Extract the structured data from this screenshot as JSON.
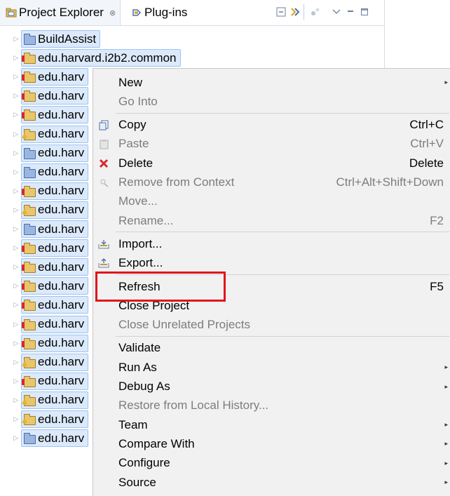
{
  "tabs": [
    {
      "label": "Project Explorer",
      "close_glyph": "⊗",
      "icon": "project-explorer-icon"
    },
    {
      "label": "Plug-ins",
      "icon": "plugins-icon"
    }
  ],
  "view_toolbar": [
    "collapse-all-icon",
    "link-with-editor-icon",
    "filter-icon",
    "view-menu-icon",
    "minimize-icon",
    "maximize-icon"
  ],
  "tree": [
    {
      "label": "BuildAssist",
      "marker": "none",
      "folder": "plain"
    },
    {
      "label": "edu.harvard.i2b2.common",
      "marker": "error",
      "folder": "yellow"
    },
    {
      "label": "edu.harv",
      "marker": "error",
      "folder": "yellow"
    },
    {
      "label": "edu.harv",
      "marker": "error",
      "folder": "yellow"
    },
    {
      "label": "edu.harv",
      "marker": "error",
      "folder": "yellow"
    },
    {
      "label": "edu.harv",
      "marker": "warning",
      "folder": "yellow"
    },
    {
      "label": "edu.harv",
      "marker": "none",
      "folder": "plain"
    },
    {
      "label": "edu.harv",
      "marker": "none",
      "folder": "plain"
    },
    {
      "label": "edu.harv",
      "marker": "error",
      "folder": "yellow"
    },
    {
      "label": "edu.harv",
      "marker": "warning",
      "folder": "yellow"
    },
    {
      "label": "edu.harv",
      "marker": "none",
      "folder": "plain"
    },
    {
      "label": "edu.harv",
      "marker": "error",
      "folder": "yellow"
    },
    {
      "label": "edu.harv",
      "marker": "error",
      "folder": "yellow"
    },
    {
      "label": "edu.harv",
      "marker": "error",
      "folder": "yellow"
    },
    {
      "label": "edu.harv",
      "marker": "error",
      "folder": "yellow"
    },
    {
      "label": "edu.harv",
      "marker": "error",
      "folder": "yellow"
    },
    {
      "label": "edu.harv",
      "marker": "error",
      "folder": "yellow"
    },
    {
      "label": "edu.harv",
      "marker": "warning",
      "folder": "yellow"
    },
    {
      "label": "edu.harv",
      "marker": "error",
      "folder": "yellow"
    },
    {
      "label": "edu.harv",
      "marker": "warning",
      "folder": "yellow"
    },
    {
      "label": "edu.harv",
      "marker": "warning",
      "folder": "yellow"
    },
    {
      "label": "edu.harv",
      "marker": "none",
      "folder": "plain"
    }
  ],
  "menu": {
    "items": [
      {
        "label": "New",
        "key": "",
        "submenu": true,
        "enabled": true,
        "icon": ""
      },
      {
        "label": "Go Into",
        "key": "",
        "submenu": false,
        "enabled": false,
        "icon": ""
      },
      {
        "sep": true
      },
      {
        "label": "Copy",
        "key": "Ctrl+C",
        "submenu": false,
        "enabled": true,
        "icon": "copy-icon"
      },
      {
        "label": "Paste",
        "key": "Ctrl+V",
        "submenu": false,
        "enabled": false,
        "icon": "paste-icon"
      },
      {
        "label": "Delete",
        "key": "Delete",
        "submenu": false,
        "enabled": true,
        "icon": "delete-icon"
      },
      {
        "label": "Remove from Context",
        "key": "Ctrl+Alt+Shift+Down",
        "submenu": false,
        "enabled": false,
        "icon": "remove-context-icon"
      },
      {
        "label": "Move...",
        "key": "",
        "submenu": false,
        "enabled": false,
        "icon": ""
      },
      {
        "label": "Rename...",
        "key": "F2",
        "submenu": false,
        "enabled": false,
        "icon": ""
      },
      {
        "sep": true
      },
      {
        "label": "Import...",
        "key": "",
        "submenu": false,
        "enabled": true,
        "icon": "import-icon"
      },
      {
        "label": "Export...",
        "key": "",
        "submenu": false,
        "enabled": true,
        "icon": "export-icon"
      },
      {
        "sep": true
      },
      {
        "label": "Refresh",
        "key": "F5",
        "submenu": false,
        "enabled": true,
        "icon": ""
      },
      {
        "label": "Close Project",
        "key": "",
        "submenu": false,
        "enabled": true,
        "icon": ""
      },
      {
        "label": "Close Unrelated Projects",
        "key": "",
        "submenu": false,
        "enabled": false,
        "icon": ""
      },
      {
        "sep": true
      },
      {
        "label": "Validate",
        "key": "",
        "submenu": false,
        "enabled": true,
        "icon": ""
      },
      {
        "label": "Run As",
        "key": "",
        "submenu": true,
        "enabled": true,
        "icon": ""
      },
      {
        "label": "Debug As",
        "key": "",
        "submenu": true,
        "enabled": true,
        "icon": ""
      },
      {
        "label": "Restore from Local History...",
        "key": "",
        "submenu": false,
        "enabled": false,
        "icon": ""
      },
      {
        "label": "Team",
        "key": "",
        "submenu": true,
        "enabled": true,
        "icon": ""
      },
      {
        "label": "Compare With",
        "key": "",
        "submenu": true,
        "enabled": true,
        "icon": ""
      },
      {
        "label": "Configure",
        "key": "",
        "submenu": true,
        "enabled": true,
        "icon": ""
      },
      {
        "label": "Source",
        "key": "",
        "submenu": true,
        "enabled": true,
        "icon": ""
      }
    ]
  },
  "annotation": {
    "target": "Refresh",
    "color": "#e0161b"
  },
  "colors": {
    "selection_bg": "#dbe9fa",
    "selection_border": "#9ec3f0",
    "menu_bg": "#f1f1f1",
    "disabled_text": "#7d7d7d",
    "error": "#d9262b",
    "warning": "#e8b32c"
  }
}
